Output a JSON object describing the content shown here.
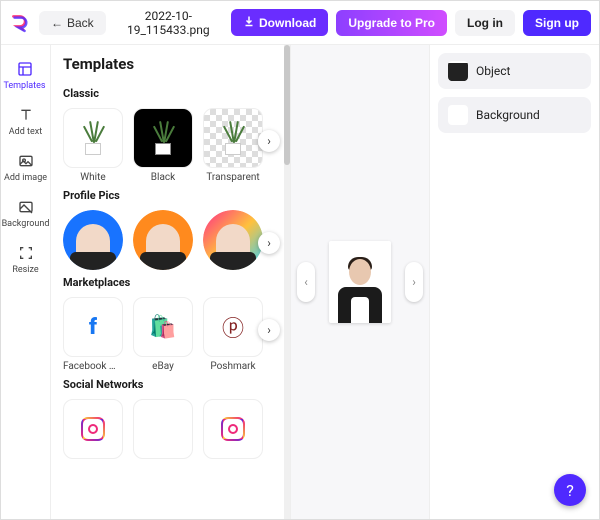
{
  "header": {
    "back_label": "Back",
    "filename": "2022-10-19_115433.png",
    "download_label": "Download",
    "upgrade_label": "Upgrade to Pro",
    "login_label": "Log in",
    "signup_label": "Sign up"
  },
  "rail": {
    "items": [
      {
        "label": "Templates",
        "active": true
      },
      {
        "label": "Add text",
        "active": false
      },
      {
        "label": "Add image",
        "active": false
      },
      {
        "label": "Background",
        "active": false
      },
      {
        "label": "Resize",
        "active": false
      }
    ]
  },
  "templates": {
    "title": "Templates",
    "sections": [
      {
        "title": "Classic",
        "items": [
          {
            "label": "White"
          },
          {
            "label": "Black"
          },
          {
            "label": "Transparent"
          }
        ]
      },
      {
        "title": "Profile Pics",
        "items": [
          {
            "label": ""
          },
          {
            "label": ""
          },
          {
            "label": ""
          }
        ]
      },
      {
        "title": "Marketplaces",
        "items": [
          {
            "label": "Facebook Ma…"
          },
          {
            "label": "eBay"
          },
          {
            "label": "Poshmark"
          }
        ]
      },
      {
        "title": "Social Networks",
        "items": [
          {
            "label": ""
          },
          {
            "label": ""
          },
          {
            "label": ""
          }
        ]
      }
    ]
  },
  "rightpanel": {
    "options": [
      {
        "label": "Object"
      },
      {
        "label": "Background"
      }
    ]
  },
  "colors": {
    "primary": "#4f29ff",
    "accent": "#6a2dff"
  }
}
